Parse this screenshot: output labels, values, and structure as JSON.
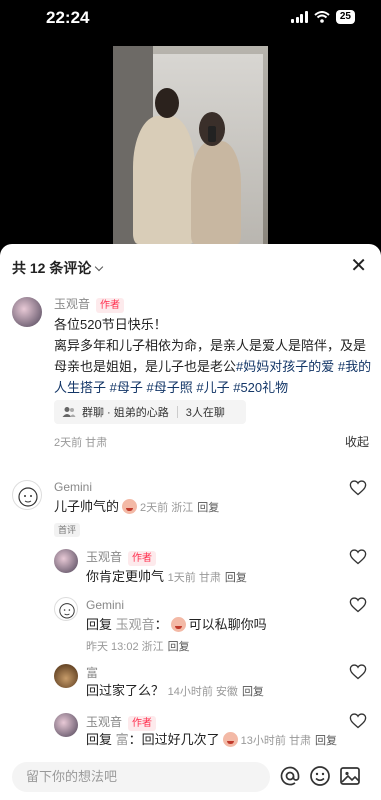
{
  "status": {
    "time": "22:24",
    "battery": "25"
  },
  "sheet": {
    "title": "共 12 条评论"
  },
  "comments": [
    {
      "name": "玉观音",
      "author_tag": "作者",
      "text_parts": [
        "各位520节日快乐！",
        "离异多年和儿子相依为命，是亲人是爱人是陪伴，及是母亲也是姐姐，是儿子也是老公",
        "#妈妈对孩子的爱",
        "#我的人生搭子",
        "#母子",
        "#母子照",
        "#儿子",
        "#520礼物"
      ],
      "group_label": "群聊 · 姐弟的心路",
      "group_count": "3人在聊",
      "time": "2天前 甘肃",
      "collapse": "收起"
    },
    {
      "name": "Gemini",
      "text": "儿子帅气的",
      "time": "2天前 浙江",
      "reply": "回复",
      "badge": "首评"
    }
  ],
  "replies": [
    {
      "name": "玉观音",
      "author_tag": "作者",
      "text": "你肯定更帅气",
      "time": "1天前 甘肃",
      "reply": "回复"
    },
    {
      "name": "Gemini",
      "prefix": "回复 ",
      "mention": "玉观音",
      "text": "可以私聊你吗",
      "time": "昨天 13:02 浙江",
      "reply": "回复"
    },
    {
      "name": "富",
      "text": "回过家了么？",
      "time": "14小时前 安徽",
      "reply": "回复"
    },
    {
      "name": "玉观音",
      "author_tag": "作者",
      "prefix": "回复 ",
      "mention": "富",
      "text": "回过好几次了",
      "time": "13小时前 甘肃",
      "reply": "回复"
    }
  ],
  "input": {
    "placeholder": "留下你的想法吧"
  },
  "colors": {
    "author": "#ff2e4d",
    "hashtag": "#133667",
    "meta": "#999999"
  }
}
